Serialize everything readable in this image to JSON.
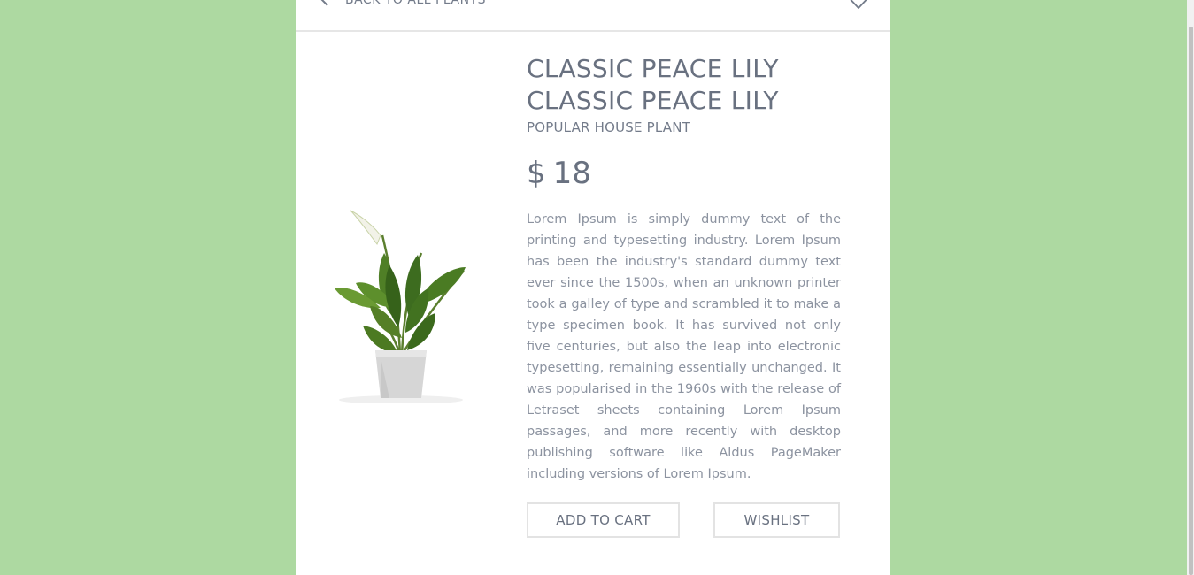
{
  "header": {
    "back_label": "BACK TO ALL PLANTS"
  },
  "product": {
    "title_line_1": "CLASSIC PEACE LILY",
    "title_line_2": "CLASSIC PEACE LILY",
    "subtitle": "POPULAR HOUSE PLANT",
    "price_currency": "$",
    "price_amount": "18",
    "description": "Lorem Ipsum is simply dummy text of the printing and typesetting industry. Lorem Ipsum has been the industry's standard dummy text ever since the 1500s, when an unknown printer took a galley of type and scrambled it to make a type specimen book. It has survived not only five centuries, but also the leap into electronic typesetting, remaining essentially unchanged. It was popularised in the 1960s with the release of Letraset sheets containing Lorem Ipsum passages, and more recently with desktop publishing software like Aldus PageMaker including versions of Lorem Ipsum."
  },
  "actions": {
    "add_to_cart_label": "ADD TO CART",
    "wishlist_label": "WISHLIST"
  },
  "icons": {
    "back": "chevron-left-icon",
    "wishlist": "heart-icon"
  },
  "colors": {
    "page_background": "#add9a1",
    "card_background": "#ffffff",
    "text": "#697180",
    "border": "#e3e3e3"
  }
}
